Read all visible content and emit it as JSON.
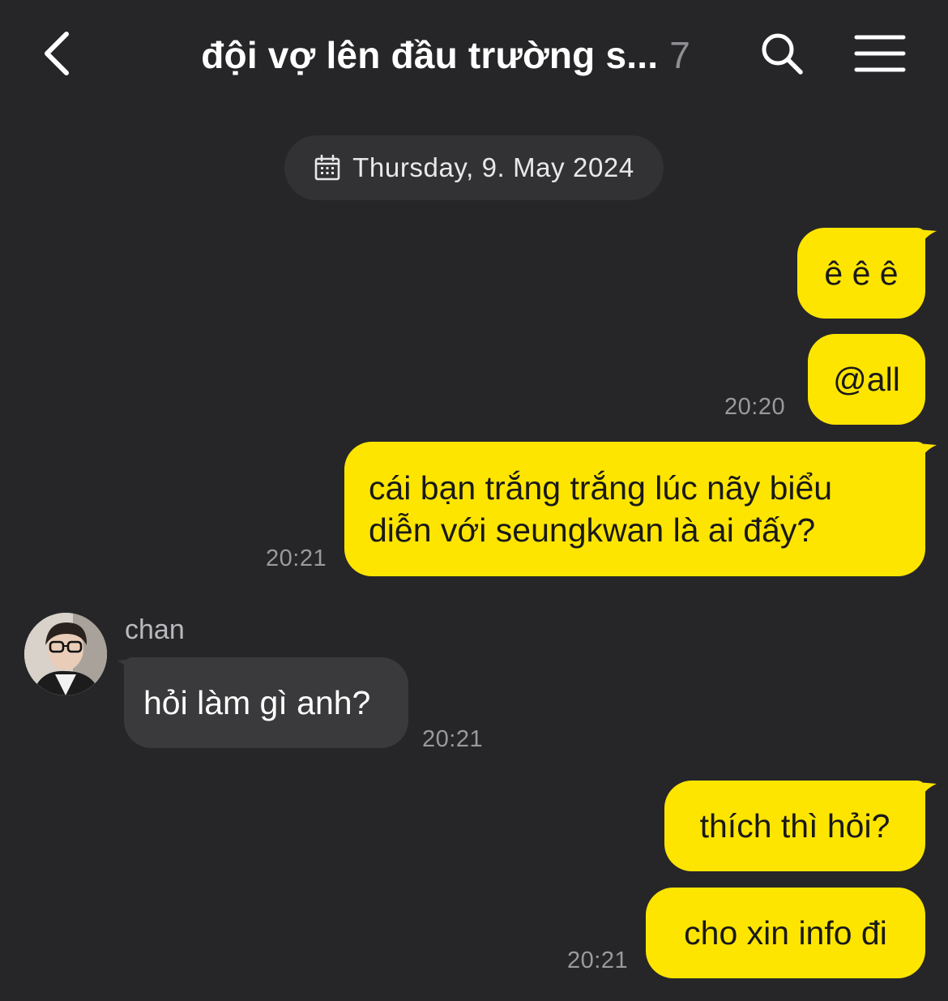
{
  "header": {
    "title": "đội vợ lên đầu trường s...",
    "member_count": "7"
  },
  "date_divider": {
    "text": "Thursday, 9. May 2024",
    "icon": "calendar-icon"
  },
  "messages": [
    {
      "from": "me",
      "text": "ê ê ê",
      "time": ""
    },
    {
      "from": "me",
      "text": "@all",
      "time": "20:20"
    },
    {
      "from": "me",
      "text": "cái bạn trắng trắng lúc nãy biểu diễn với seungkwan là ai đấy?",
      "time": "20:21"
    },
    {
      "from": "chan",
      "sender": "chan",
      "text": "hỏi làm gì anh?",
      "time": "20:21"
    },
    {
      "from": "me",
      "text": "thích thì hỏi?",
      "time": ""
    },
    {
      "from": "me",
      "text": "cho xin info đi",
      "time": "20:21"
    }
  ],
  "colors": {
    "background": "#262628",
    "my_bubble": "#fee500",
    "other_bubble": "#3a3a3c",
    "timestamp": "#9a9a9e"
  }
}
